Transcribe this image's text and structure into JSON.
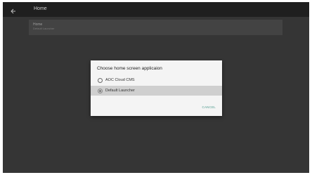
{
  "appbar": {
    "title": "Home",
    "back_icon": "arrow-back-icon"
  },
  "settings_row": {
    "title": "Home",
    "summary": "Default Launcher"
  },
  "dialog": {
    "title": "Choose home screen applicaion",
    "options": [
      {
        "label": "AOC Cloud CMS",
        "selected": false
      },
      {
        "label": "Default Launcher",
        "selected": true
      }
    ],
    "cancel_label": "CANCEL"
  },
  "colors": {
    "appbar": "#1f1f1f",
    "background": "#4a4a4a",
    "dialog": "#f4f4f4",
    "selected_row": "#cfcfcf",
    "accent": "#4e9a8e"
  }
}
